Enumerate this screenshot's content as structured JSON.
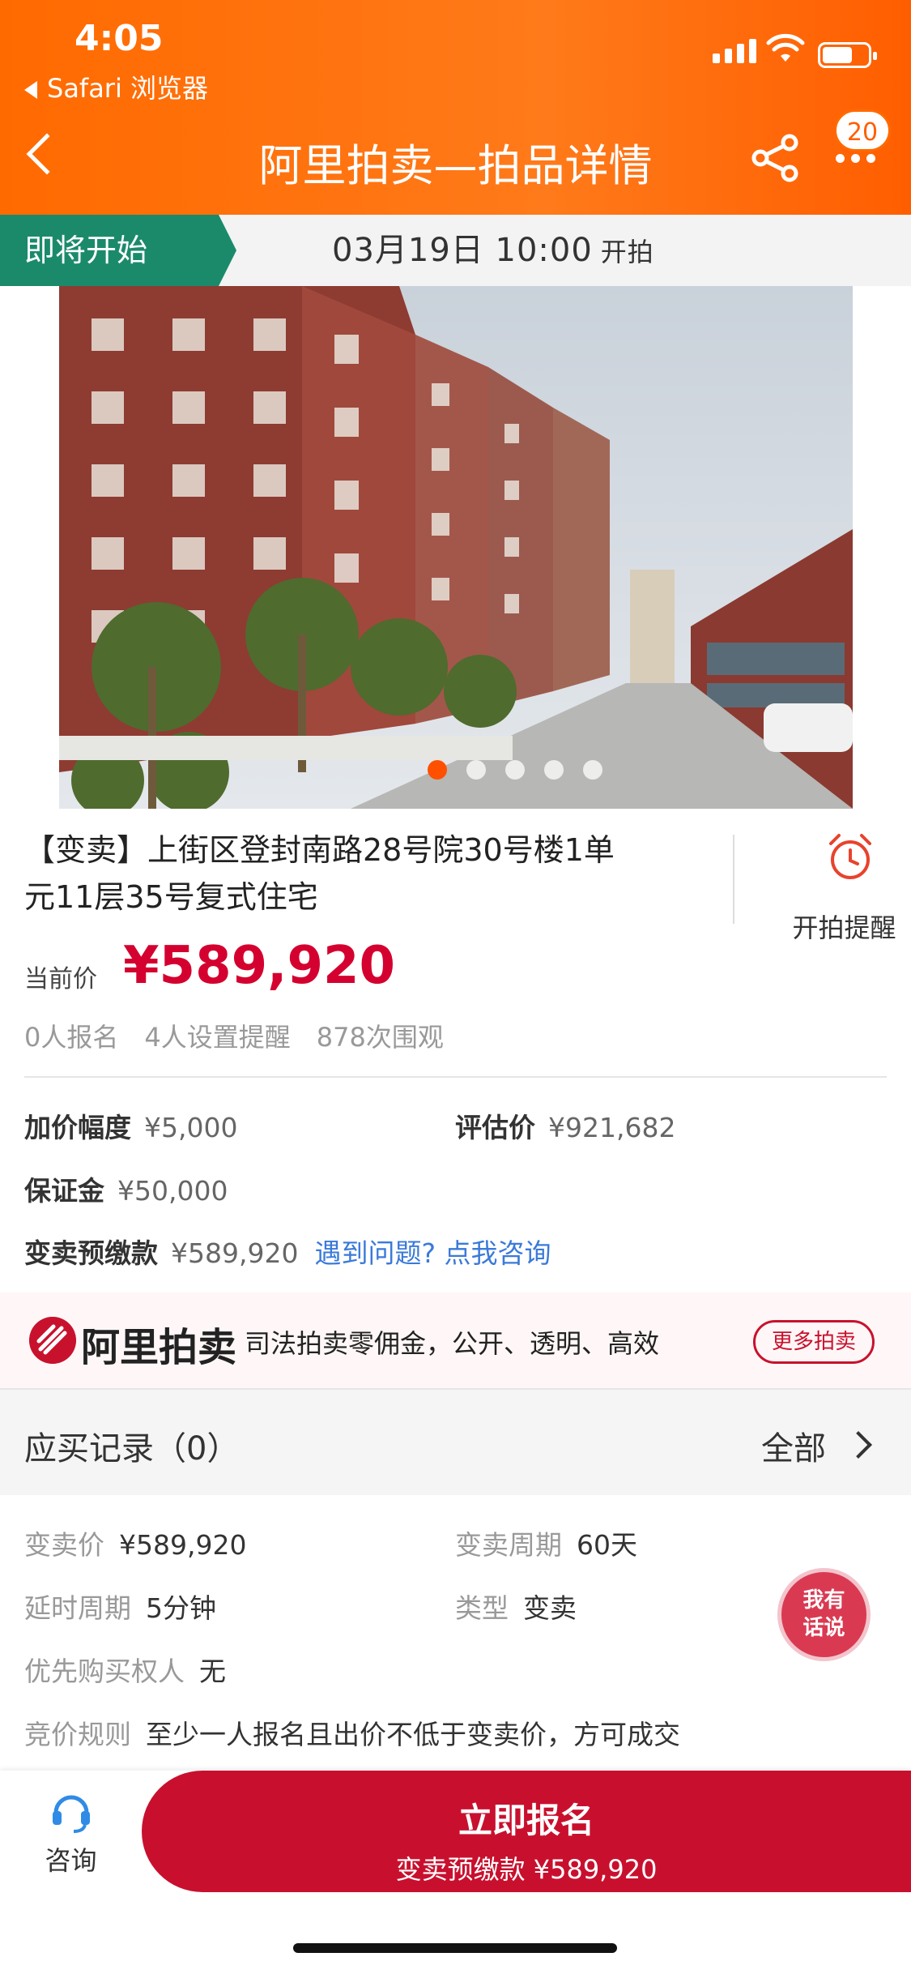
{
  "status_bar": {
    "time": "4:05",
    "back_app": "Safari 浏览器"
  },
  "nav": {
    "title": "阿里拍卖—拍品详情",
    "badge": "20"
  },
  "strip": {
    "tag": "即将开始",
    "datetime": "03月19日 10:00",
    "suffix": "开拍"
  },
  "item": {
    "title_line1": "【变卖】上街区登封南路28号院30号楼1单",
    "title_line2": "元11层35号复式住宅",
    "reminder": "开拍提醒",
    "price_label": "当前价",
    "price": "¥589,920",
    "stats": [
      "0人报名",
      "4人设置提醒",
      "878次围观"
    ]
  },
  "details": {
    "increment_k": "加价幅度",
    "increment_v": "¥5,000",
    "appraisal_k": "评估价",
    "appraisal_v": "¥921,682",
    "deposit_k": "保证金",
    "deposit_v": "¥50,000",
    "prepay_k": "变卖预缴款",
    "prepay_v": "¥589,920",
    "help_link": "遇到问题? 点我咨询"
  },
  "brand": {
    "name": "阿里拍卖",
    "slogan": "司法拍卖零佣金，公开、透明、高效",
    "more": "更多拍卖"
  },
  "records": {
    "title": "应买记录（0）",
    "all": "全部"
  },
  "info": {
    "sale_price_k": "变卖价",
    "sale_price_v": "¥589,920",
    "period_k": "变卖周期",
    "period_v": "60天",
    "delay_k": "延时周期",
    "delay_v": "5分钟",
    "type_k": "类型",
    "type_v": "变卖",
    "priority_k": "优先购买权人",
    "priority_v": "无",
    "rule_k": "竞价规则",
    "rule_v": "至少一人报名且出价不低于变卖价，方可成交"
  },
  "chat": {
    "line1": "我有",
    "line2": "话说"
  },
  "bottom": {
    "consult": "咨询",
    "signup": "立即报名",
    "signup_sub": "变卖预缴款 ¥589,920"
  },
  "colors": {
    "header_orange": "#ff6a00",
    "tag_green": "#1b8a6b",
    "price_red": "#d4002f",
    "signup_red": "#c8102e",
    "link_blue": "#3a7ad9"
  },
  "carousel": {
    "pages": 5,
    "active": 1
  }
}
